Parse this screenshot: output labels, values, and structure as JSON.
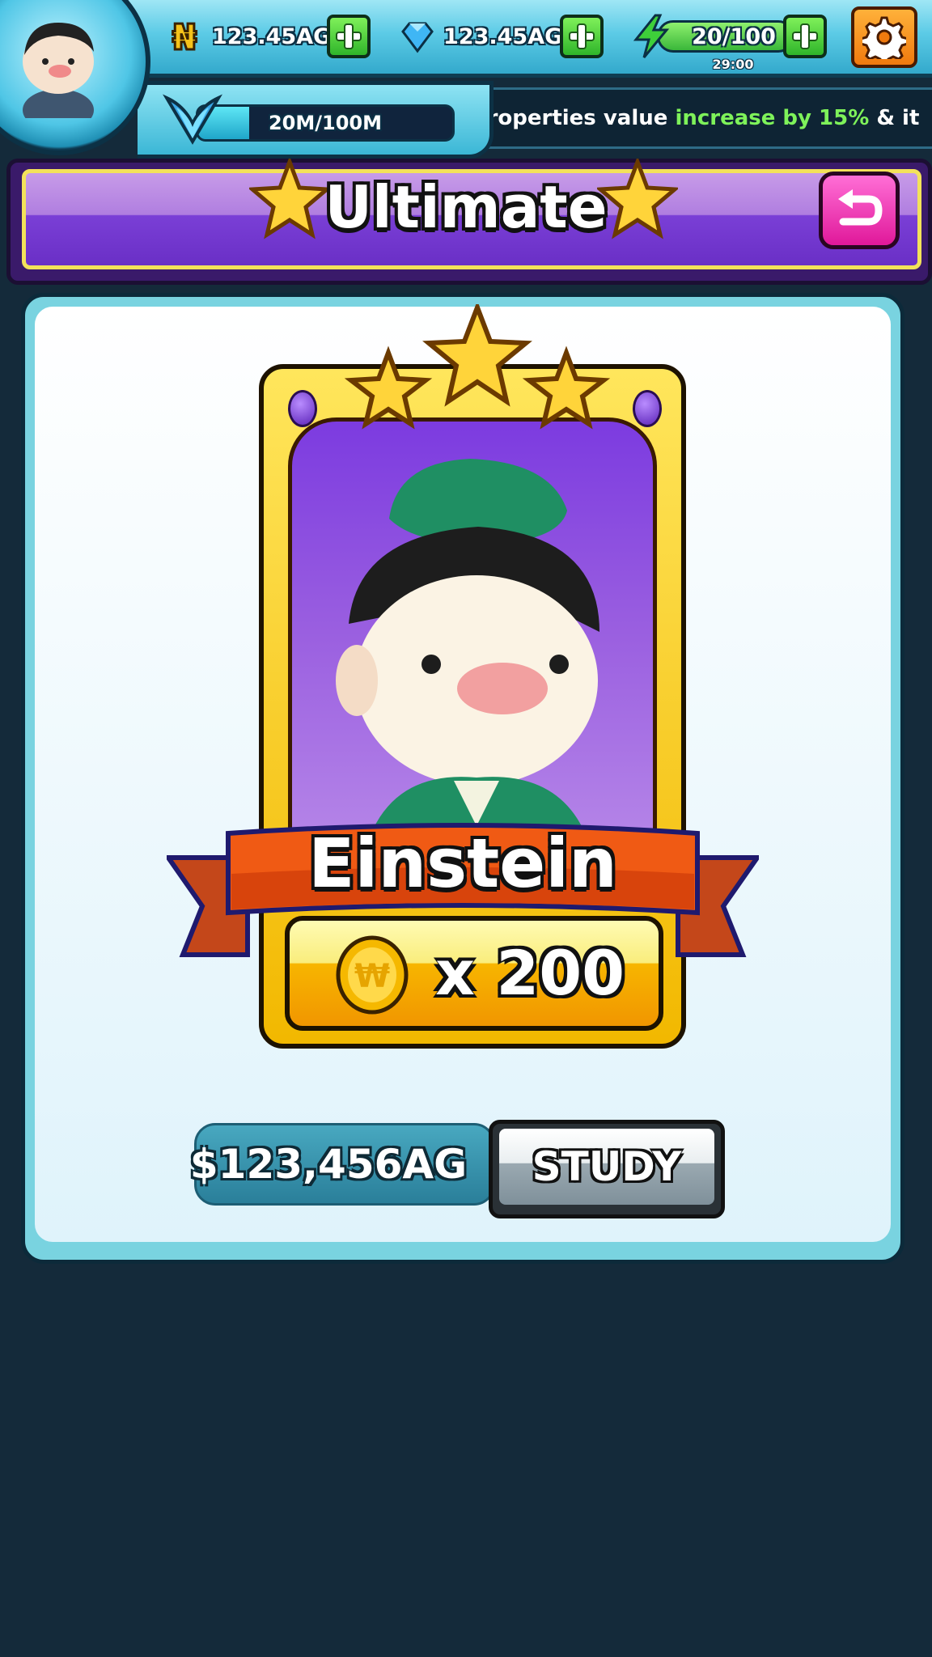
{
  "hud": {
    "gold": {
      "value": "123.45AG",
      "icon": "naira-coin-icon",
      "color": "#f5c21a"
    },
    "gems": {
      "value": "123.45AG",
      "icon": "diamond-icon",
      "color": "#3fb6f5"
    },
    "energy": {
      "value": "20/100",
      "timer": "29:00",
      "icon": "lightning-icon",
      "color": "#5fd63a"
    },
    "xp": {
      "value": "20M/100M",
      "progress": 0.2,
      "icon": "wings-icon"
    },
    "ticker": {
      "before": "l properties value ",
      "highlight": "increase by 15%",
      "after": " & it"
    }
  },
  "title": {
    "text": "Ultimate"
  },
  "card": {
    "name": "Einstein",
    "cost_multiplier": "x 200",
    "rarity_stars": 3,
    "accent_color": "#7c3be0"
  },
  "actions": {
    "price": "$123,456AG",
    "study_label": "STUDY"
  }
}
